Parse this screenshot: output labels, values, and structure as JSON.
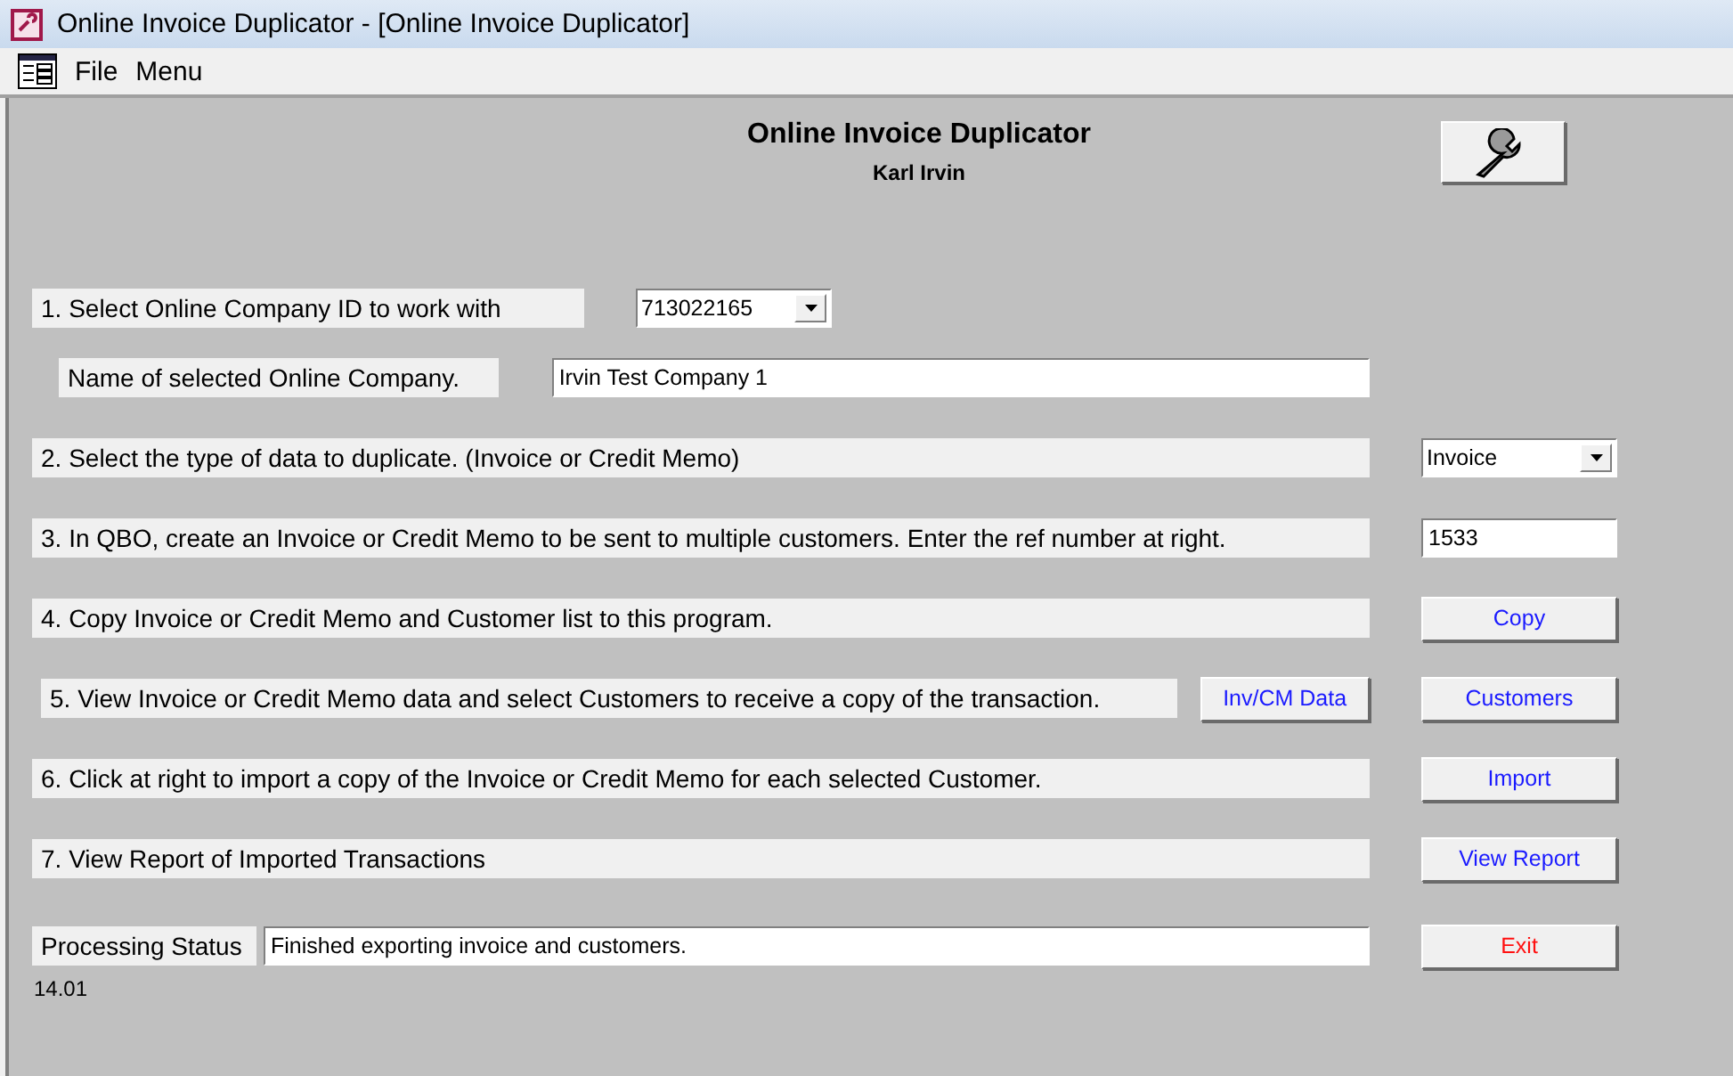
{
  "window": {
    "title": "Online Invoice Duplicator - [Online Invoice Duplicator]"
  },
  "menu": [
    "File",
    "Menu"
  ],
  "header": {
    "title": "Online Invoice Duplicator",
    "user": "Karl Irvin"
  },
  "steps": [
    {
      "kind": "dropdown",
      "label": "1. Select Online Company ID to work with",
      "value": "713022165"
    },
    {
      "kind": "name",
      "label": "Name of selected Online Company.",
      "value": "Irvin Test Company 1"
    },
    {
      "kind": "dropdown",
      "label": "2. Select the type of data to duplicate. (Invoice or Credit Memo)",
      "value": "Invoice"
    },
    {
      "kind": "field",
      "label": "3. In QBO, create an Invoice or Credit Memo to be sent to multiple customers. Enter the ref number at right.",
      "value": "1533"
    },
    {
      "kind": "button",
      "label": "4. Copy Invoice or Credit Memo and Customer list to this program.",
      "button": "Copy"
    },
    {
      "kind": "button",
      "label": "5. View Invoice or Credit Memo data and select Customers to receive a copy of the transaction.",
      "extra_button": "Inv/CM Data",
      "button": "Customers"
    },
    {
      "kind": "button",
      "label": "6. Click at right to import a copy of the Invoice or Credit Memo for each selected Customer.",
      "button": "Import"
    },
    {
      "kind": "button",
      "label": "7. View Report of Imported Transactions",
      "button": "View Report"
    }
  ],
  "status": {
    "label": "Processing Status",
    "value": "Finished exporting invoice and customers.",
    "exit": "Exit"
  },
  "version": "14.01"
}
